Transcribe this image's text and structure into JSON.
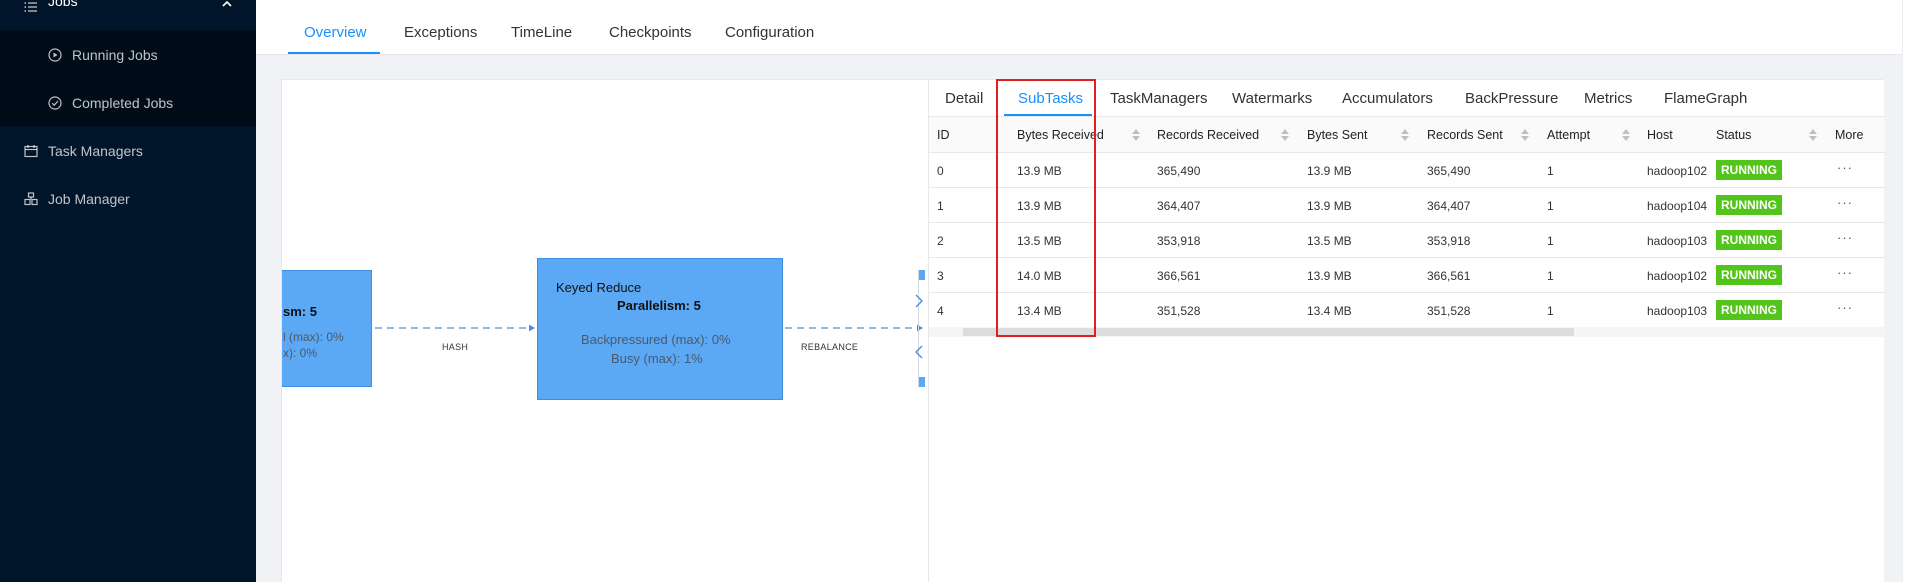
{
  "sidebar": {
    "jobs_label": "Jobs",
    "running_jobs_label": "Running Jobs",
    "completed_jobs_label": "Completed Jobs",
    "task_managers_label": "Task Managers",
    "job_manager_label": "Job Manager"
  },
  "top_tabs": [
    "Overview",
    "Exceptions",
    "TimeLine",
    "Checkpoints",
    "Configuration"
  ],
  "graph": {
    "left_node": {
      "parallelism_label": "sm: 5",
      "backpressured_label": "l (max): 0%",
      "busy_label": "x): 0%"
    },
    "right_node": {
      "title": "Keyed Reduce",
      "parallelism_label": "Parallelism: 5",
      "backpressured_label": "Backpressured (max): 0%",
      "busy_label": "Busy (max): 1%"
    },
    "edge_labels": [
      "HASH",
      "REBALANCE"
    ]
  },
  "detail_tabs": [
    "Detail",
    "SubTasks",
    "TaskManagers",
    "Watermarks",
    "Accumulators",
    "BackPressure",
    "Metrics",
    "FlameGraph"
  ],
  "table": {
    "headers": [
      "ID",
      "Bytes Received",
      "Records Received",
      "Bytes Sent",
      "Records Sent",
      "Attempt",
      "Host",
      "Status",
      "More"
    ],
    "rows": [
      {
        "id": "0",
        "bytes_received": "13.9 MB",
        "records_received": "365,490",
        "bytes_sent": "13.9 MB",
        "records_sent": "365,490",
        "attempt": "1",
        "host": "hadoop102",
        "status": "RUNNING",
        "more": "···"
      },
      {
        "id": "1",
        "bytes_received": "13.9 MB",
        "records_received": "364,407",
        "bytes_sent": "13.9 MB",
        "records_sent": "364,407",
        "attempt": "1",
        "host": "hadoop104",
        "status": "RUNNING",
        "more": "···"
      },
      {
        "id": "2",
        "bytes_received": "13.5 MB",
        "records_received": "353,918",
        "bytes_sent": "13.5 MB",
        "records_sent": "353,918",
        "attempt": "1",
        "host": "hadoop103",
        "status": "RUNNING",
        "more": "···"
      },
      {
        "id": "3",
        "bytes_received": "14.0 MB",
        "records_received": "366,561",
        "bytes_sent": "13.9 MB",
        "records_sent": "366,561",
        "attempt": "1",
        "host": "hadoop102",
        "status": "RUNNING",
        "more": "···"
      },
      {
        "id": "4",
        "bytes_received": "13.4 MB",
        "records_received": "351,528",
        "bytes_sent": "13.4 MB",
        "records_sent": "351,528",
        "attempt": "1",
        "host": "hadoop103",
        "status": "RUNNING",
        "more": "···"
      }
    ]
  },
  "colors": {
    "accent": "#1890ff",
    "sidebar_bg": "#001529",
    "node_fill": "#5ba8f5",
    "status_running": "#52c41a",
    "highlight": "#e0201f"
  }
}
